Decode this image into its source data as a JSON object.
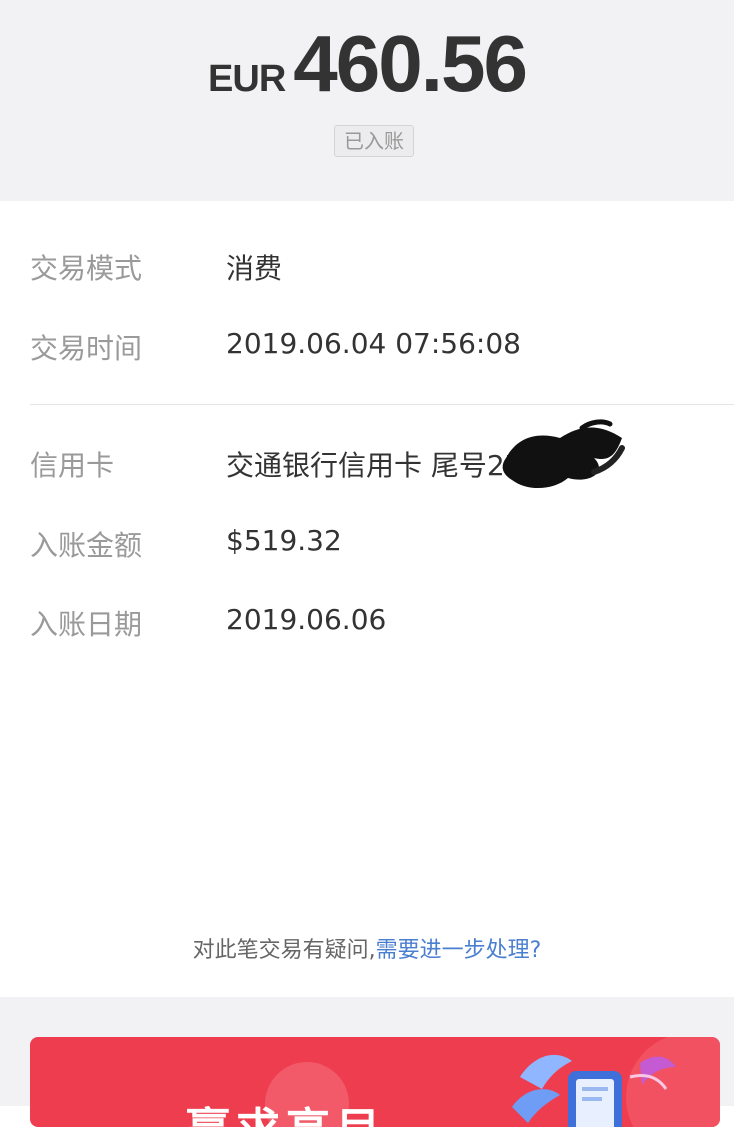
{
  "header": {
    "currency": "EUR",
    "amount": "460.56",
    "status_badge": "已入账"
  },
  "details": [
    {
      "label": "交易模式",
      "value": "消费"
    },
    {
      "label": "交易时间",
      "value": "2019.06.04 07:56:08"
    },
    {
      "label": "信用卡",
      "value": "交通银行信用卡 尾号2780"
    },
    {
      "label": "入账金额",
      "value": "$519.32"
    },
    {
      "label": "入账日期",
      "value": "2019.06.06"
    }
  ],
  "footer": {
    "question_text": "对此笔交易有疑问,",
    "question_link": "需要进一步处理?"
  },
  "banner": {
    "title": "赢求高目",
    "color": "#ee3d4f"
  },
  "colors": {
    "link": "#4a7fd0",
    "background_gray": "#f2f2f4"
  }
}
